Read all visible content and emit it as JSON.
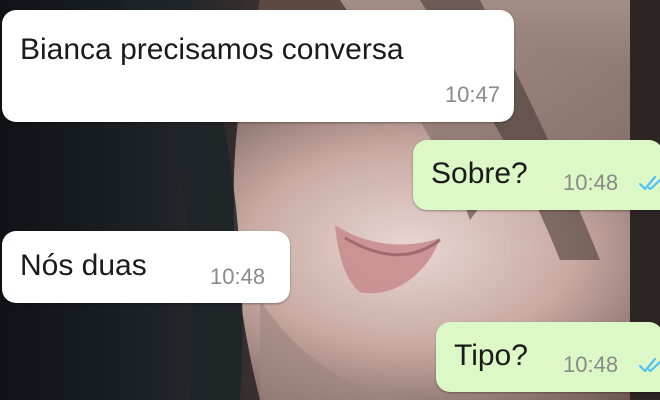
{
  "conversation": {
    "messages": [
      {
        "direction": "incoming",
        "text": "Bianca precisamos conversa",
        "time": "10:47"
      },
      {
        "direction": "outgoing",
        "text": "Sobre?",
        "time": "10:48",
        "status_icon": "double-check-icon"
      },
      {
        "direction": "incoming",
        "text": "Nós duas",
        "time": "10:48"
      },
      {
        "direction": "outgoing",
        "text": "Tipo?",
        "time": "10:48",
        "status_icon": "double-check-icon"
      }
    ]
  },
  "colors": {
    "incoming_bubble": "#ffffff",
    "outgoing_bubble": "#dcf8c6",
    "timestamp": "#8a8a8a",
    "read_ticks": "#4fc3f7"
  }
}
